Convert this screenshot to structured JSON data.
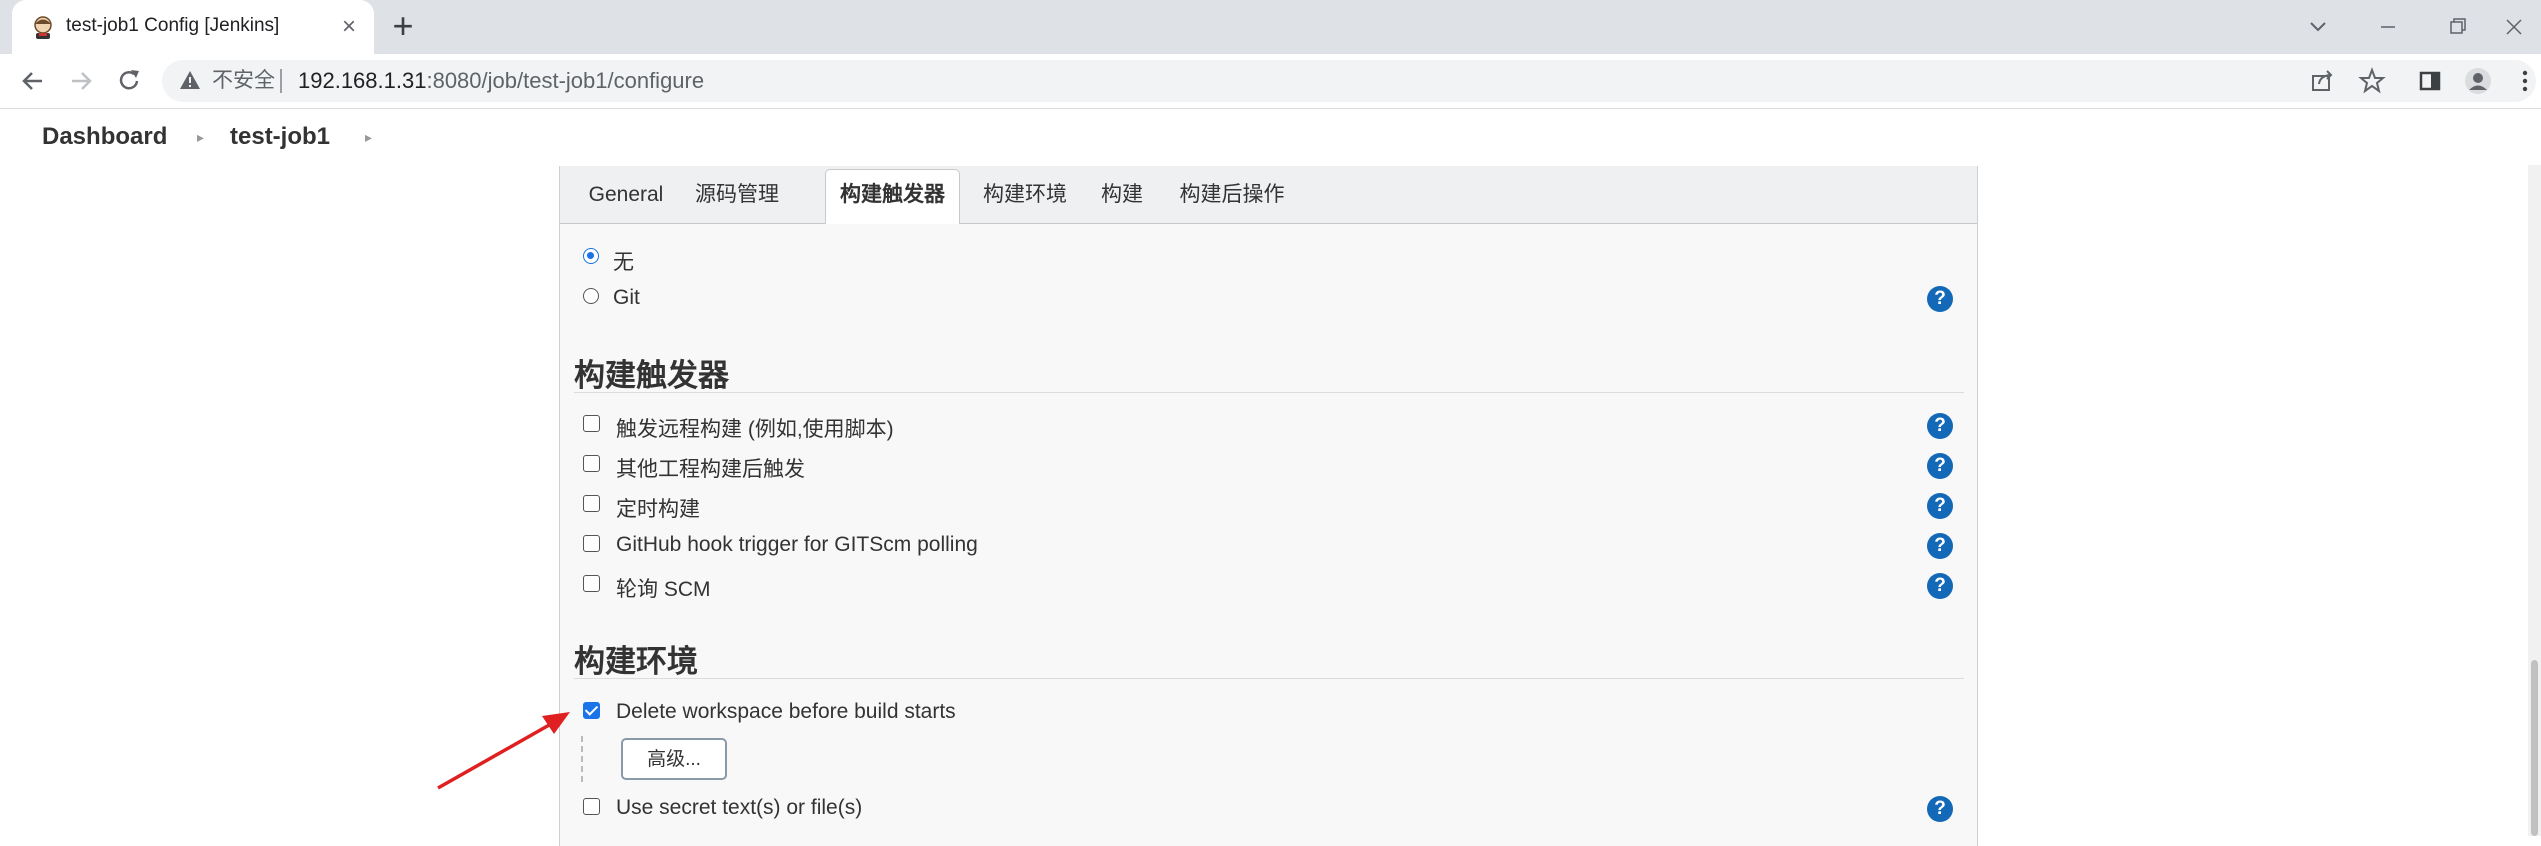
{
  "browser": {
    "tab_title": "test-job1 Config [Jenkins]",
    "new_tab_symbol": "+",
    "close_symbol": "×",
    "insecure_label": "不安全",
    "url_host": "192.168.1.31",
    "url_rest": ":8080/job/test-job1/configure",
    "icons": [
      "jenkins-favicon",
      "back-icon",
      "forward-icon",
      "reload-icon",
      "warning-icon",
      "share-icon",
      "star-icon",
      "sidebar-icon",
      "profile-icon",
      "menu-icon",
      "minimize-icon",
      "restore-icon",
      "close-window-icon",
      "tab-search-icon"
    ]
  },
  "breadcrumb": {
    "items": [
      "Dashboard",
      "test-job1"
    ]
  },
  "tabs": [
    "General",
    "源码管理",
    "构建触发器",
    "构建环境",
    "构建",
    "构建后操作"
  ],
  "active_tab": "构建触发器",
  "scm": {
    "options": [
      {
        "label": "无",
        "selected": true
      },
      {
        "label": "Git",
        "selected": false
      }
    ]
  },
  "triggers": {
    "title": "构建触发器",
    "items": [
      {
        "label": "触发远程构建 (例如,使用脚本)",
        "checked": false
      },
      {
        "label": "其他工程构建后触发",
        "checked": false
      },
      {
        "label": "定时构建",
        "checked": false
      },
      {
        "label": "GitHub hook trigger for GITScm polling",
        "checked": false
      },
      {
        "label": "轮询 SCM",
        "checked": false
      }
    ]
  },
  "environment": {
    "title": "构建环境",
    "items": [
      {
        "label": "Delete workspace before build starts",
        "checked": true
      },
      {
        "label": "Use secret text(s) or file(s)",
        "checked": false
      }
    ],
    "advanced_button": "高级..."
  },
  "help_symbol": "?",
  "colors": {
    "accent": "#1a73e8",
    "help": "#1369b8",
    "arrow": "#e02020"
  }
}
